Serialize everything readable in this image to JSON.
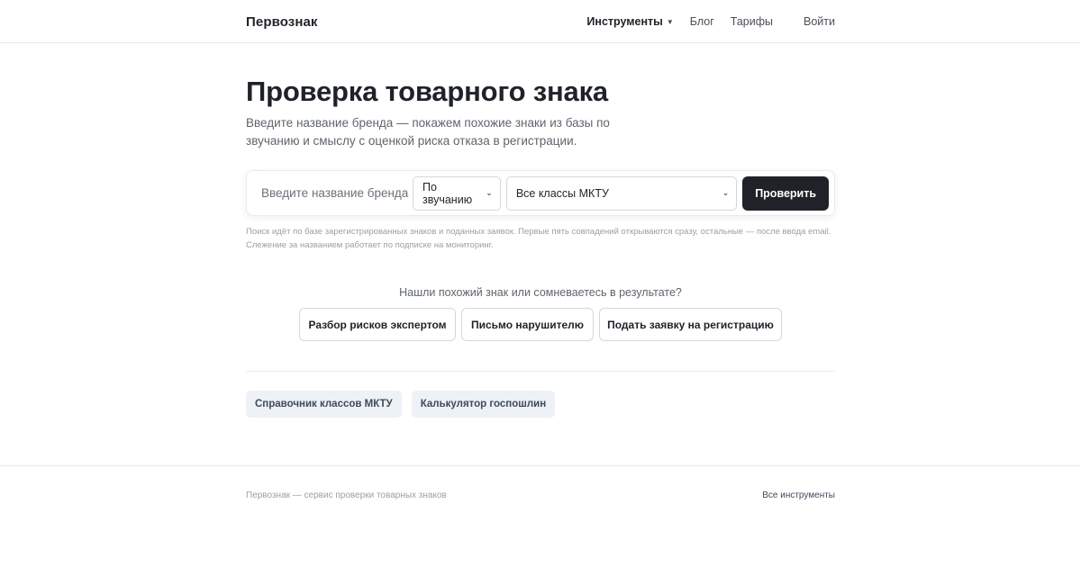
{
  "header": {
    "logo": "Первознак",
    "nav": {
      "tools": "Инструменты",
      "blog": "Блог",
      "pricing": "Тарифы",
      "login": "Войти"
    }
  },
  "main": {
    "title": "Проверка товарного знака",
    "subtitle": "Введите название бренда — покажем похожие знаки из базы по звучанию и смыслу с оценкой риска отказа в регистрации.",
    "search": {
      "placeholder": "Введите название бренда",
      "mode_selected": "По звучанию",
      "class_selected": "Все классы МКТУ",
      "submit_label": "Проверить"
    },
    "hint": "Поиск идёт по базе зарегистрированных знаков и поданных заявок. Первые пять совпадений открываются сразу, остальные — после ввода email. Слежение за названием работает по подписке на мониторинг.",
    "cta": {
      "question": "Нашли похожий знак или сомневаетесь в результате?",
      "buttons": [
        "Разбор рисков экспертом",
        "Письмо нарушителю",
        "Подать заявку на регистрацию"
      ]
    },
    "chips": [
      "Справочник классов МКТУ",
      "Калькулятор госпошлин"
    ]
  },
  "footer": {
    "left": "Первознак — сервис проверки товарных знаков",
    "right": "Все инструменты"
  },
  "colors": {
    "primary": "#1f2329",
    "chip_bg": "#eef1f5",
    "border": "#e8eaed"
  }
}
